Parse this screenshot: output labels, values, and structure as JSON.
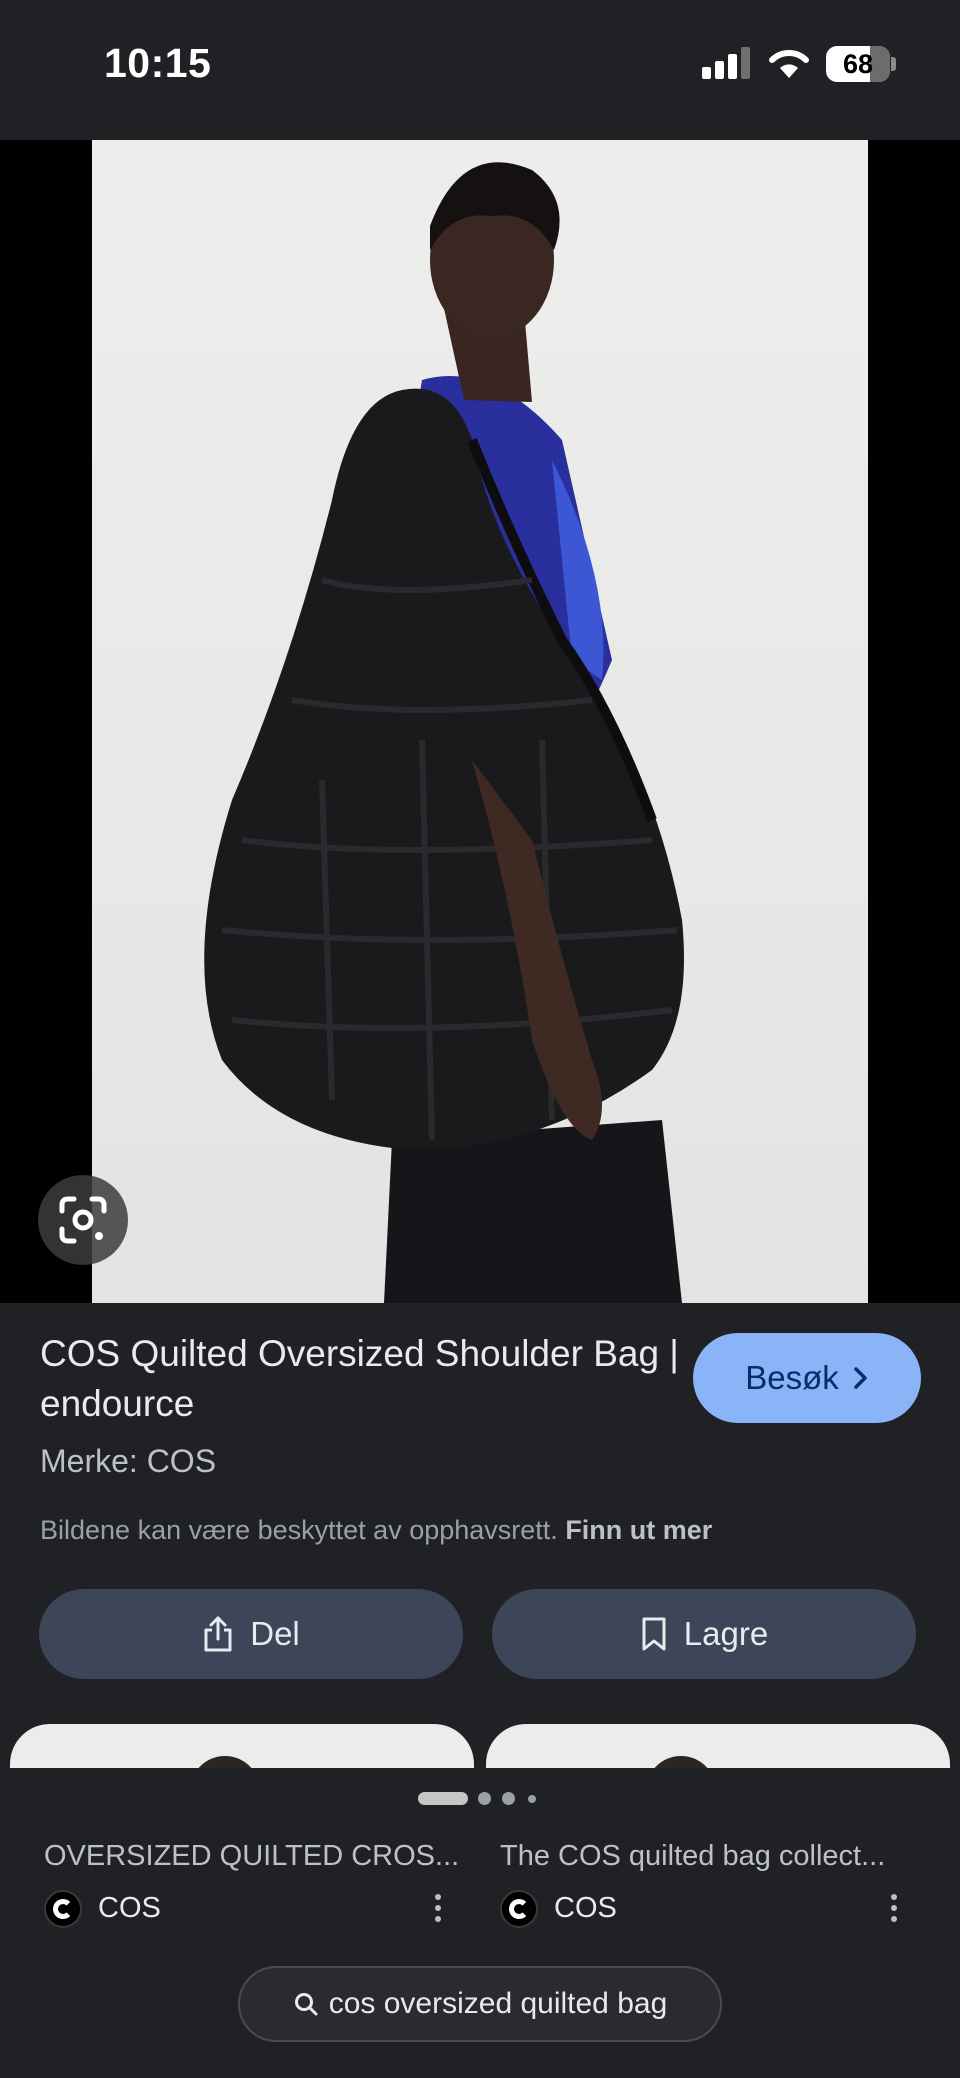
{
  "status_bar": {
    "time": "10:15",
    "battery_level": "68",
    "signal_bars_active": 3,
    "signal_bars_total": 4
  },
  "image_viewer": {
    "lens_icon": "google-lens-icon"
  },
  "result": {
    "title": "COS Quilted Oversized Shoulder Bag | endource",
    "brand": "Merke: COS",
    "copyright_notice": "Bildene kan være beskyttet av opphavsrett.",
    "learn_more_label": "Finn ut mer",
    "visit_label": "Besøk",
    "share_label": "Del",
    "save_label": "Lagre"
  },
  "carousel": {
    "page_count": 4,
    "active_index": 0
  },
  "related_items": [
    {
      "title": "OVERSIZED QUILTED CROS...",
      "source": "COS"
    },
    {
      "title": "The COS quilted bag collect...",
      "source": "COS"
    }
  ],
  "search_chip": {
    "query": "cos oversized quilted bag"
  },
  "colors": {
    "background": "#202124",
    "visit_button": "#8ab4f8",
    "action_button": "#3c4658",
    "text_primary": "#e8eaed",
    "text_secondary": "#9aa0a6"
  }
}
